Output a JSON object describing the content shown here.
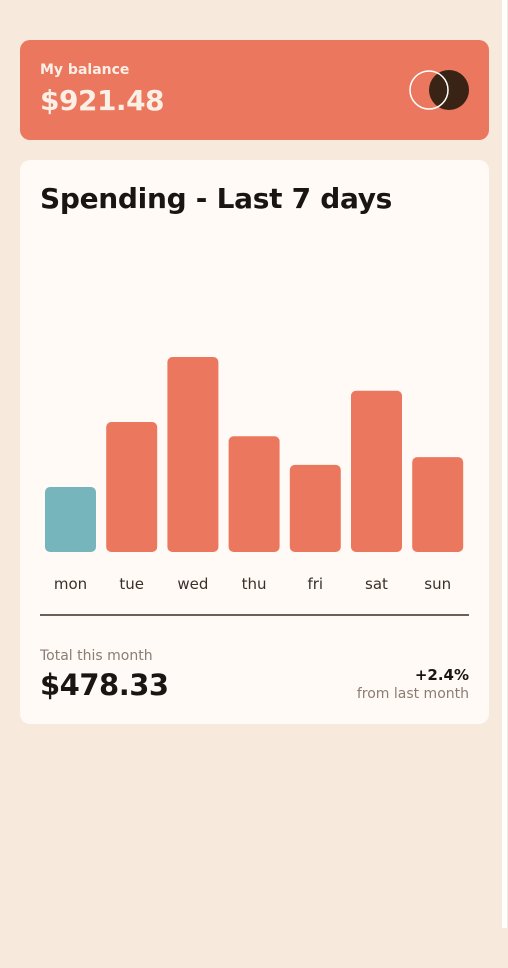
{
  "balance": {
    "label": "My balance",
    "value": "$921.48"
  },
  "logo": {
    "icon": "two-overlapping-circles-logo",
    "color_outline": "#ffffff",
    "color_fill": "#382314"
  },
  "spending": {
    "title": "Spending - Last 7 days",
    "total_label": "Total this month",
    "total_value": "$478.33",
    "change_value": "+2.4%",
    "change_label": "from last month"
  },
  "colors": {
    "background": "#f8e9dd",
    "accent": "#ec775f",
    "highlight": "#76b5bc",
    "card": "#fffaf5",
    "text": "#1a1512",
    "muted": "#8a7d74"
  },
  "chart_data": {
    "type": "bar",
    "categories": [
      "mon",
      "tue",
      "wed",
      "thu",
      "fri",
      "sat",
      "sun"
    ],
    "values": [
      17.45,
      34.91,
      52.36,
      31.07,
      23.39,
      43.28,
      25.48
    ],
    "highlighted_category": "mon",
    "title": "",
    "xlabel": "",
    "ylabel": "",
    "grid": false
  }
}
